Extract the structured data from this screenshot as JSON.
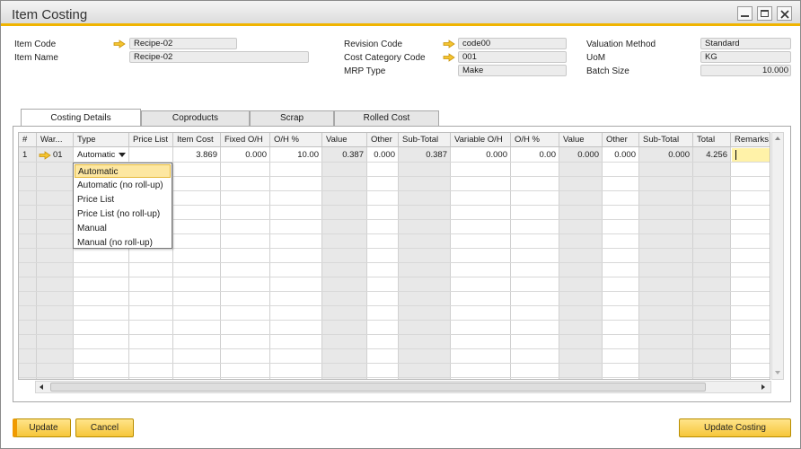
{
  "window": {
    "title": "Item Costing"
  },
  "header": {
    "item_code_label": "Item Code",
    "item_code": "Recipe-02",
    "item_name_label": "Item Name",
    "item_name": "Recipe-02",
    "revision_code_label": "Revision Code",
    "revision_code": "code00",
    "cost_category_code_label": "Cost Category Code",
    "cost_category_code": "001",
    "mrp_type_label": "MRP Type",
    "mrp_type": "Make",
    "valuation_method_label": "Valuation Method",
    "valuation_method": "Standard",
    "uom_label": "UoM",
    "uom": "KG",
    "batch_size_label": "Batch Size",
    "batch_size": "10.000"
  },
  "tabs": [
    {
      "label": "Costing Details"
    },
    {
      "label": "Coproducts"
    },
    {
      "label": "Scrap"
    },
    {
      "label": "Rolled Cost"
    }
  ],
  "grid": {
    "columns": [
      "#",
      "War...",
      "Type",
      "Price List",
      "Item Cost",
      "Fixed O/H",
      "O/H %",
      "Value",
      "Other",
      "Sub-Total",
      "Variable O/H",
      "O/H %",
      "Value",
      "Other",
      "Sub-Total",
      "Total",
      "Remarks"
    ],
    "row": {
      "num": "1",
      "warehouse": "01",
      "type": "Automatic",
      "price_list": "",
      "item_cost": "3.869",
      "fixed_oh": "0.000",
      "fixed_oh_pct": "10.00",
      "fixed_value": "0.387",
      "fixed_other": "0.000",
      "fixed_subtotal": "0.387",
      "variable_oh": "0.000",
      "variable_oh_pct": "0.00",
      "variable_value": "0.000",
      "variable_other": "0.000",
      "variable_subtotal": "0.000",
      "total": "4.256",
      "remarks": ""
    }
  },
  "type_dropdown": {
    "options": [
      "Automatic",
      "Automatic (no roll-up)",
      "Price List",
      "Price List (no roll-up)",
      "Manual",
      "Manual (no roll-up)"
    ],
    "selected_index": 0
  },
  "footer": {
    "update_label": "Update",
    "cancel_label": "Cancel",
    "update_costing_label": "Update Costing"
  },
  "colors": {
    "accent": "#f0b400",
    "button": "#f6c63a",
    "selection": "#fde7a1"
  }
}
